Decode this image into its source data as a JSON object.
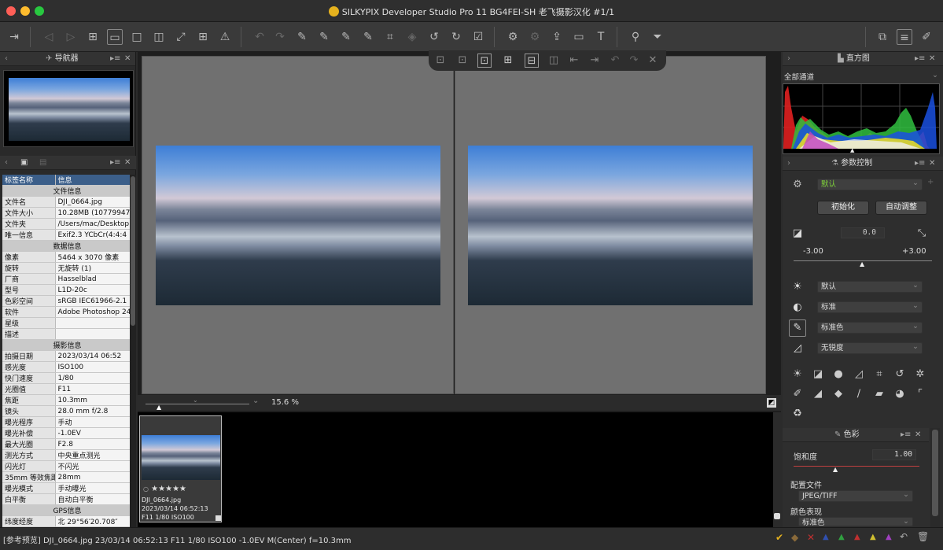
{
  "window": {
    "title": "SILKYPIX Developer Studio Pro 11 BG4FEI-SH 老飞摄影汉化   #1/1"
  },
  "navigator": {
    "title": "导航器"
  },
  "info_table": {
    "col_tag": "标签名称",
    "col_info": "信息",
    "rows": [
      {
        "sec": "文件信息"
      },
      {
        "k": "文件名",
        "v": "DJI_0664.jpg"
      },
      {
        "k": "文件大小",
        "v": "10.28MB (10779947"
      },
      {
        "k": "文件夹",
        "v": "/Users/mac/Desktop"
      },
      {
        "k": "唯一信息",
        "v": "Exif2.3 YCbCr(4:4:4"
      },
      {
        "sec": "数据信息"
      },
      {
        "k": "像素",
        "v": "5464 x 3070 像素"
      },
      {
        "k": "旋转",
        "v": "无旋转 (1)"
      },
      {
        "k": "厂商",
        "v": "Hasselblad"
      },
      {
        "k": "型号",
        "v": "L1D-20c"
      },
      {
        "k": "色彩空间",
        "v": "sRGB IEC61966-2.1"
      },
      {
        "k": "软件",
        "v": "Adobe Photoshop 24"
      },
      {
        "k": "星级",
        "v": ""
      },
      {
        "k": "描述",
        "v": ""
      },
      {
        "sec": "摄影信息"
      },
      {
        "k": "拍摄日期",
        "v": "2023/03/14 06:52"
      },
      {
        "k": "感光度",
        "v": "ISO100"
      },
      {
        "k": "快门速度",
        "v": "1/80"
      },
      {
        "k": "光圈值",
        "v": "F11"
      },
      {
        "k": "焦距",
        "v": "10.3mm"
      },
      {
        "k": "镜头",
        "v": "28.0 mm f/2.8"
      },
      {
        "k": "曝光程序",
        "v": "手动"
      },
      {
        "k": "曝光补偿",
        "v": "-1.0EV"
      },
      {
        "k": "最大光圈",
        "v": "F2.8"
      },
      {
        "k": "测光方式",
        "v": "中央重点测光"
      },
      {
        "k": "闪光灯",
        "v": "不闪光"
      },
      {
        "k": "35mm 等效焦距",
        "v": "28mm"
      },
      {
        "k": "曝光模式",
        "v": "手动曝光"
      },
      {
        "k": "白平衡",
        "v": "自动白平衡"
      },
      {
        "sec": "GPS信息"
      },
      {
        "k": "纬度经度",
        "v": "北 29°56′20.708″"
      }
    ]
  },
  "viewer": {
    "zoom": "15.6 %"
  },
  "thumbnail": {
    "filename": "DJI_0664.jpg",
    "datetime": "2023/03/14 06:52:13",
    "exposure": "F11 1/80 ISO100",
    "rating": 0
  },
  "histogram": {
    "title": "直方图",
    "channel": "全部通道"
  },
  "params": {
    "title": "参数控制",
    "preset": "默认",
    "init_button": "初始化",
    "auto_button": "自动调整",
    "exposure_value": "0.0",
    "range_min": "-3.00",
    "range_max": "+3.00",
    "exposure_bias": 0.0,
    "wb": "默认",
    "tone": "标准",
    "color": "标准色",
    "sharpness": "无锐度"
  },
  "color_panel": {
    "title": "色彩",
    "saturation_label": "饱和度",
    "saturation_value": "1.00",
    "profile_label": "配置文件",
    "profile_value": "JPEG/TIFF",
    "expression_label": "颜色表现",
    "expression_value": "标准色"
  },
  "status": {
    "text": "[参考预览] DJI_0664.jpg 23/03/14 06:52:13 F11 1/80 ISO100 -1.0EV M(Center) f=10.3mm"
  },
  "colors": {
    "accent_green": "#7fd23a",
    "title_logo": "#e6b21e",
    "table_header": "#3c5f8a"
  }
}
